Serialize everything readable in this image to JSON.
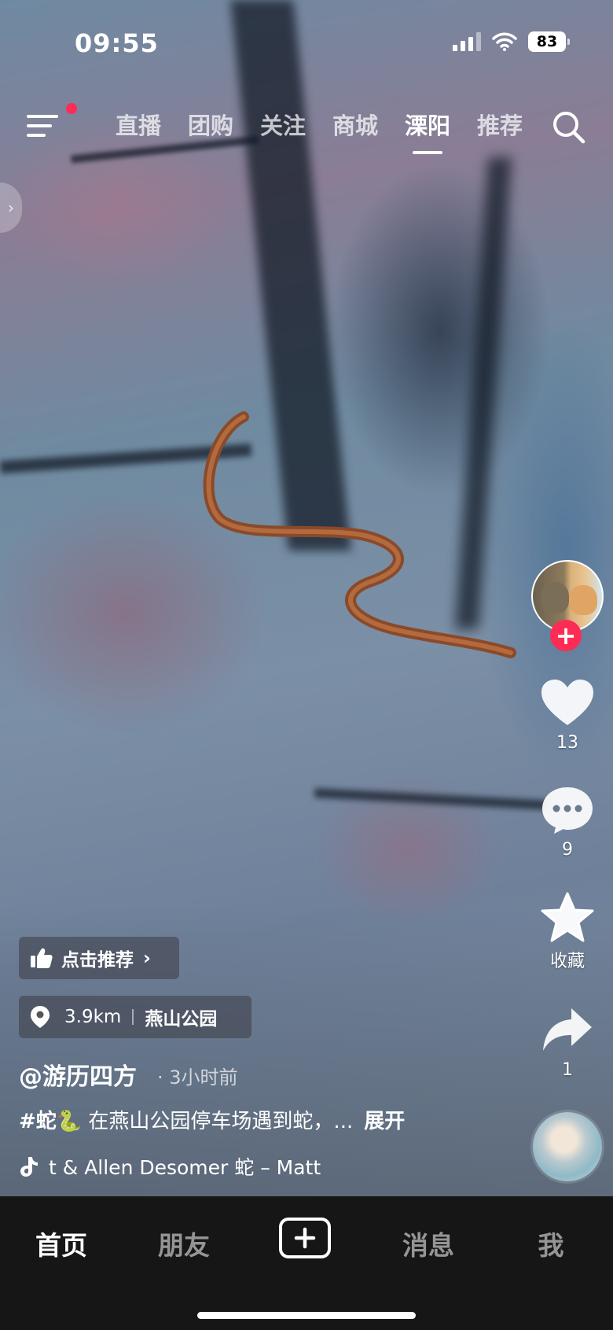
{
  "status_bar": {
    "time": "09:55",
    "battery": "83"
  },
  "top_nav": {
    "menu_icon": "menu-icon",
    "has_notification_dot": true,
    "tabs": [
      {
        "label": "直播",
        "active": false
      },
      {
        "label": "团购",
        "active": false
      },
      {
        "label": "关注",
        "active": false
      },
      {
        "label": "商城",
        "active": false
      },
      {
        "label": "溧阳",
        "active": true
      },
      {
        "label": "推荐",
        "active": false
      }
    ],
    "search_icon": "search-icon"
  },
  "right_rail": {
    "like_count": "13",
    "comment_count": "9",
    "favorite_label": "收藏",
    "share_count": "1"
  },
  "video_info": {
    "recommend_chip": "点击推荐",
    "location_distance": "3.9km",
    "location_name": "燕山公园",
    "author": "@游历四方",
    "time_ago": "· 3小时前",
    "caption_tag": "#蛇🐍",
    "caption_text": " 在燕山公园停车场遇到蛇，...",
    "expand_label": "展开",
    "music_text": "t & Allen Desomer    蛇 – Matt"
  },
  "tab_bar": {
    "tabs": [
      "首页",
      "朋友",
      "消息",
      "我"
    ],
    "active": "首页"
  },
  "colors": {
    "accent": "#fe2c55",
    "tab_bar_bg": "#161616"
  }
}
